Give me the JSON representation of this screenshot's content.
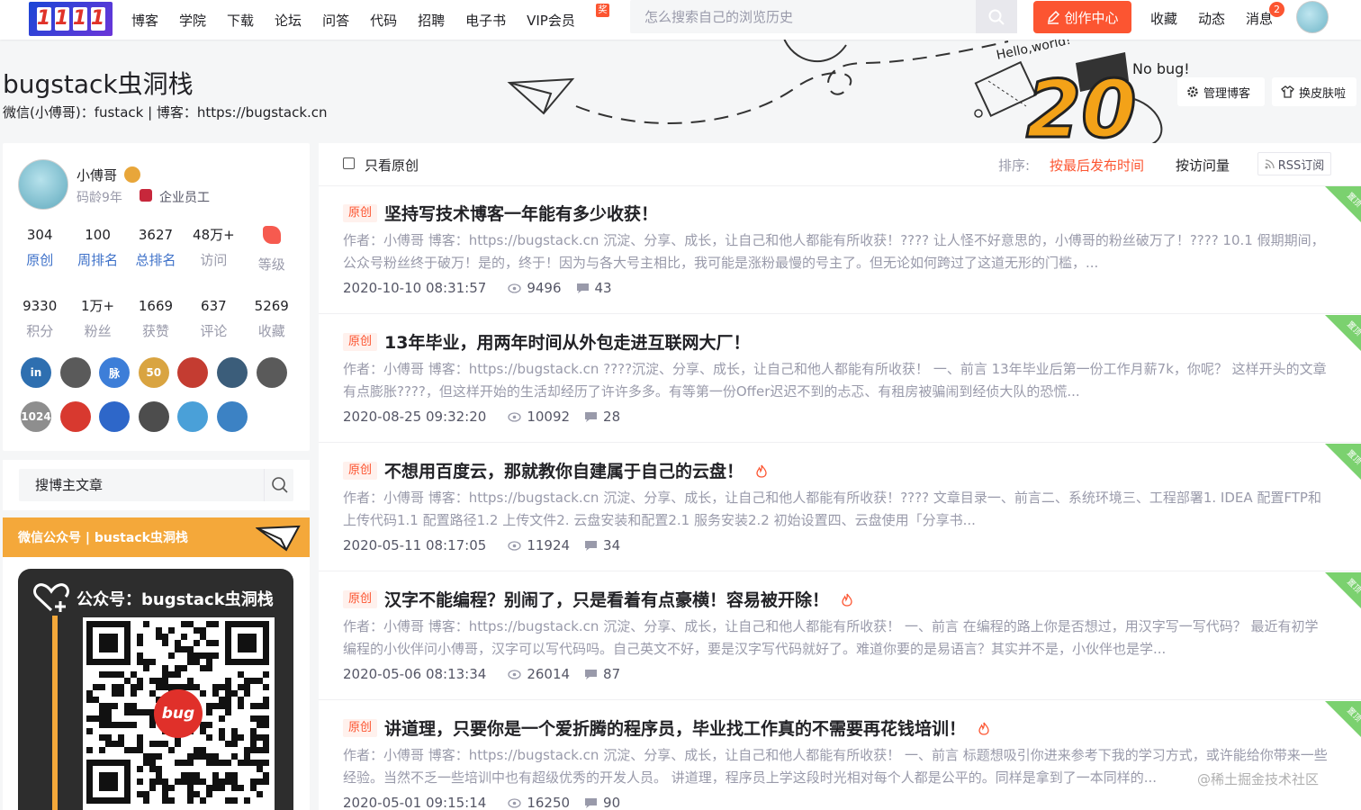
{
  "topnav": {
    "logo_chars": [
      "1",
      "1",
      "1",
      "1"
    ],
    "links": [
      "博客",
      "学院",
      "下载",
      "论坛",
      "问答",
      "代码",
      "招聘",
      "电子书",
      "VIP会员"
    ],
    "vip_badge": "奖",
    "search_placeholder": "怎么搜索自己的浏览历史",
    "create_label": "创作中心",
    "right_links": [
      "收藏",
      "动态",
      "消息"
    ],
    "message_count": "2"
  },
  "banner": {
    "title": "bugstack虫洞栈",
    "subtitle": "微信(小傅哥)：fustack | 博客：https://bugstack.cn",
    "art_text_hello": "Hello,world!",
    "art_text_nobug": "No bug!",
    "art_number": "20",
    "manage_label": "管理博客",
    "skin_label": "换皮肤啦"
  },
  "profile": {
    "name": "小傅哥",
    "age": "码龄9年",
    "corp": "企业员工",
    "stats_row1": [
      {
        "num": "304",
        "label": "原创"
      },
      {
        "num": "100",
        "label": "周排名"
      },
      {
        "num": "3627",
        "label": "总排名"
      },
      {
        "num": "48万+",
        "label": "访问"
      },
      {
        "num": "",
        "label": "等级"
      }
    ],
    "stats_row2": [
      {
        "num": "9330",
        "label": "积分"
      },
      {
        "num": "1万+",
        "label": "粉丝"
      },
      {
        "num": "1669",
        "label": "获赞"
      },
      {
        "num": "637",
        "label": "评论"
      },
      {
        "num": "5269",
        "label": "收藏"
      }
    ],
    "badges_row1": [
      {
        "icon": "linkedin-icon",
        "text": "in",
        "color": "#2e6fb0"
      },
      {
        "icon": "github-icon",
        "text": "",
        "color": "#5a5a5a"
      },
      {
        "icon": "network-icon",
        "text": "脉",
        "color": "#3d7ed8"
      },
      {
        "icon": "fifty-icon",
        "text": "50",
        "color": "#d9a441"
      },
      {
        "icon": "rocket-icon",
        "text": "",
        "color": "#c43c31"
      },
      {
        "icon": "list-icon",
        "text": "",
        "color": "#3b5d7a"
      },
      {
        "icon": "shield-icon",
        "text": "",
        "color": "#5a5a5a"
      }
    ],
    "badges_row2": [
      {
        "icon": "1024-icon",
        "text": "1024",
        "color": "#8e8e8e"
      },
      {
        "icon": "pen-icon",
        "text": "",
        "color": "#d8392f"
      },
      {
        "icon": "book-icon",
        "text": "",
        "color": "#2e67c9"
      },
      {
        "icon": "medal-icon",
        "text": "",
        "color": "#4d4d4d"
      },
      {
        "icon": "star-icon",
        "text": "",
        "color": "#4aa0d8"
      },
      {
        "icon": "crown-icon",
        "text": "",
        "color": "#3c82c4"
      }
    ]
  },
  "sidebar": {
    "search_placeholder": "搜博主文章",
    "wechat_label": "微信公众号 | bustack虫洞栈",
    "qr_title": "公众号：bugstack虫洞栈",
    "qr_logo_text": "bug"
  },
  "filter": {
    "original_only": "只看原创",
    "sort_label": "排序:",
    "sort_time": "按最后发布时间",
    "sort_views": "按访问量",
    "rss": "RSS订阅"
  },
  "articles": [
    {
      "tag": "原创",
      "title": "坚持写技术博客一年能有多少收获！",
      "hot": false,
      "desc": "作者：小傅哥 博客：https://bugstack.cn 沉淀、分享、成长，让自己和他人都能有所收获！???? 让人怪不好意思的，小傅哥的粉丝破万了！???? 10.1 假期期间，公众号粉丝终于破万！是的，终于！因为与各大号主相比，我可能是涨粉最慢的号主了。但无论如何跨过了这道无形的门槛，...",
      "date": "2020-10-10 08:31:57",
      "views": "9496",
      "comments": "43",
      "pin": "置顶"
    },
    {
      "tag": "原创",
      "title": "13年毕业，用两年时间从外包走进互联网大厂！",
      "hot": false,
      "desc": "作者：小傅哥 博客：https://bugstack.cn ????沉淀、分享、成长，让自己和他人都能有所收获！ 一、前言 13年毕业后第一份工作月薪7k，你呢？ 这样开头的文章有点膨胀????，但这样开始的生活却经历了许许多多。有等第一份Offer迟迟不到的忐忑、有租房被骗闹到经侦大队的恐慌...",
      "date": "2020-08-25 09:32:20",
      "views": "10092",
      "comments": "28",
      "pin": "置顶"
    },
    {
      "tag": "原创",
      "title": "不想用百度云，那就教你自建属于自己的云盘！",
      "hot": true,
      "desc": "作者：小傅哥 博客：https://bugstack.cn 沉淀、分享、成长，让自己和他人都能有所收获！???? 文章目录一、前言二、系统环境三、工程部署1. IDEA 配置FTP和上传代码1.1 配置路径1.2 上传文件2. 云盘安装和配置2.1 服务安装2.2 初始设置四、云盘使用「分享书...",
      "date": "2020-05-11 08:17:05",
      "views": "11924",
      "comments": "34",
      "pin": "置顶"
    },
    {
      "tag": "原创",
      "title": "汉字不能编程？别闹了，只是看着有点豪横！容易被开除！",
      "hot": true,
      "desc": "作者：小傅哥 博客：https://bugstack.cn 沉淀、分享、成长，让自己和他人都能有所收获！ 一、前言 在编程的路上你是否想过，用汉字写一写代码？ 最近有初学编程的小伙伴问小傅哥，汉字可以写代码吗。自己英文不好，要是汉字写代码就好了。难道你要的是易语言？其实并不是，小伙伴也是学...",
      "date": "2020-05-06 08:13:34",
      "views": "26014",
      "comments": "87",
      "pin": "置顶"
    },
    {
      "tag": "原创",
      "title": "讲道理，只要你是一个爱折腾的程序员，毕业找工作真的不需要再花钱培训！",
      "hot": true,
      "desc": "作者：小傅哥 博客：https://bugstack.cn 沉淀、分享、成长，让自己和他人都能有所收获！ 一、前言 标题想吸引你进来参考下我的学习方式，或许能给你带来一些经验。当然不乏一些培训中也有超级优秀的开发人员。 讲道理，程序员上学这段时光相对每个人都是公平的。同样是拿到了一本同样的...",
      "date": "2020-05-01 09:15:14",
      "views": "16250",
      "comments": "90",
      "pin": "置顶"
    }
  ],
  "watermark": "@稀土掘金技术社区",
  "colors": {
    "accent": "#fc5531",
    "link_blue": "#3e71c9",
    "wechat_orange": "#f4a83a",
    "pin_green": "#7bd16f"
  }
}
